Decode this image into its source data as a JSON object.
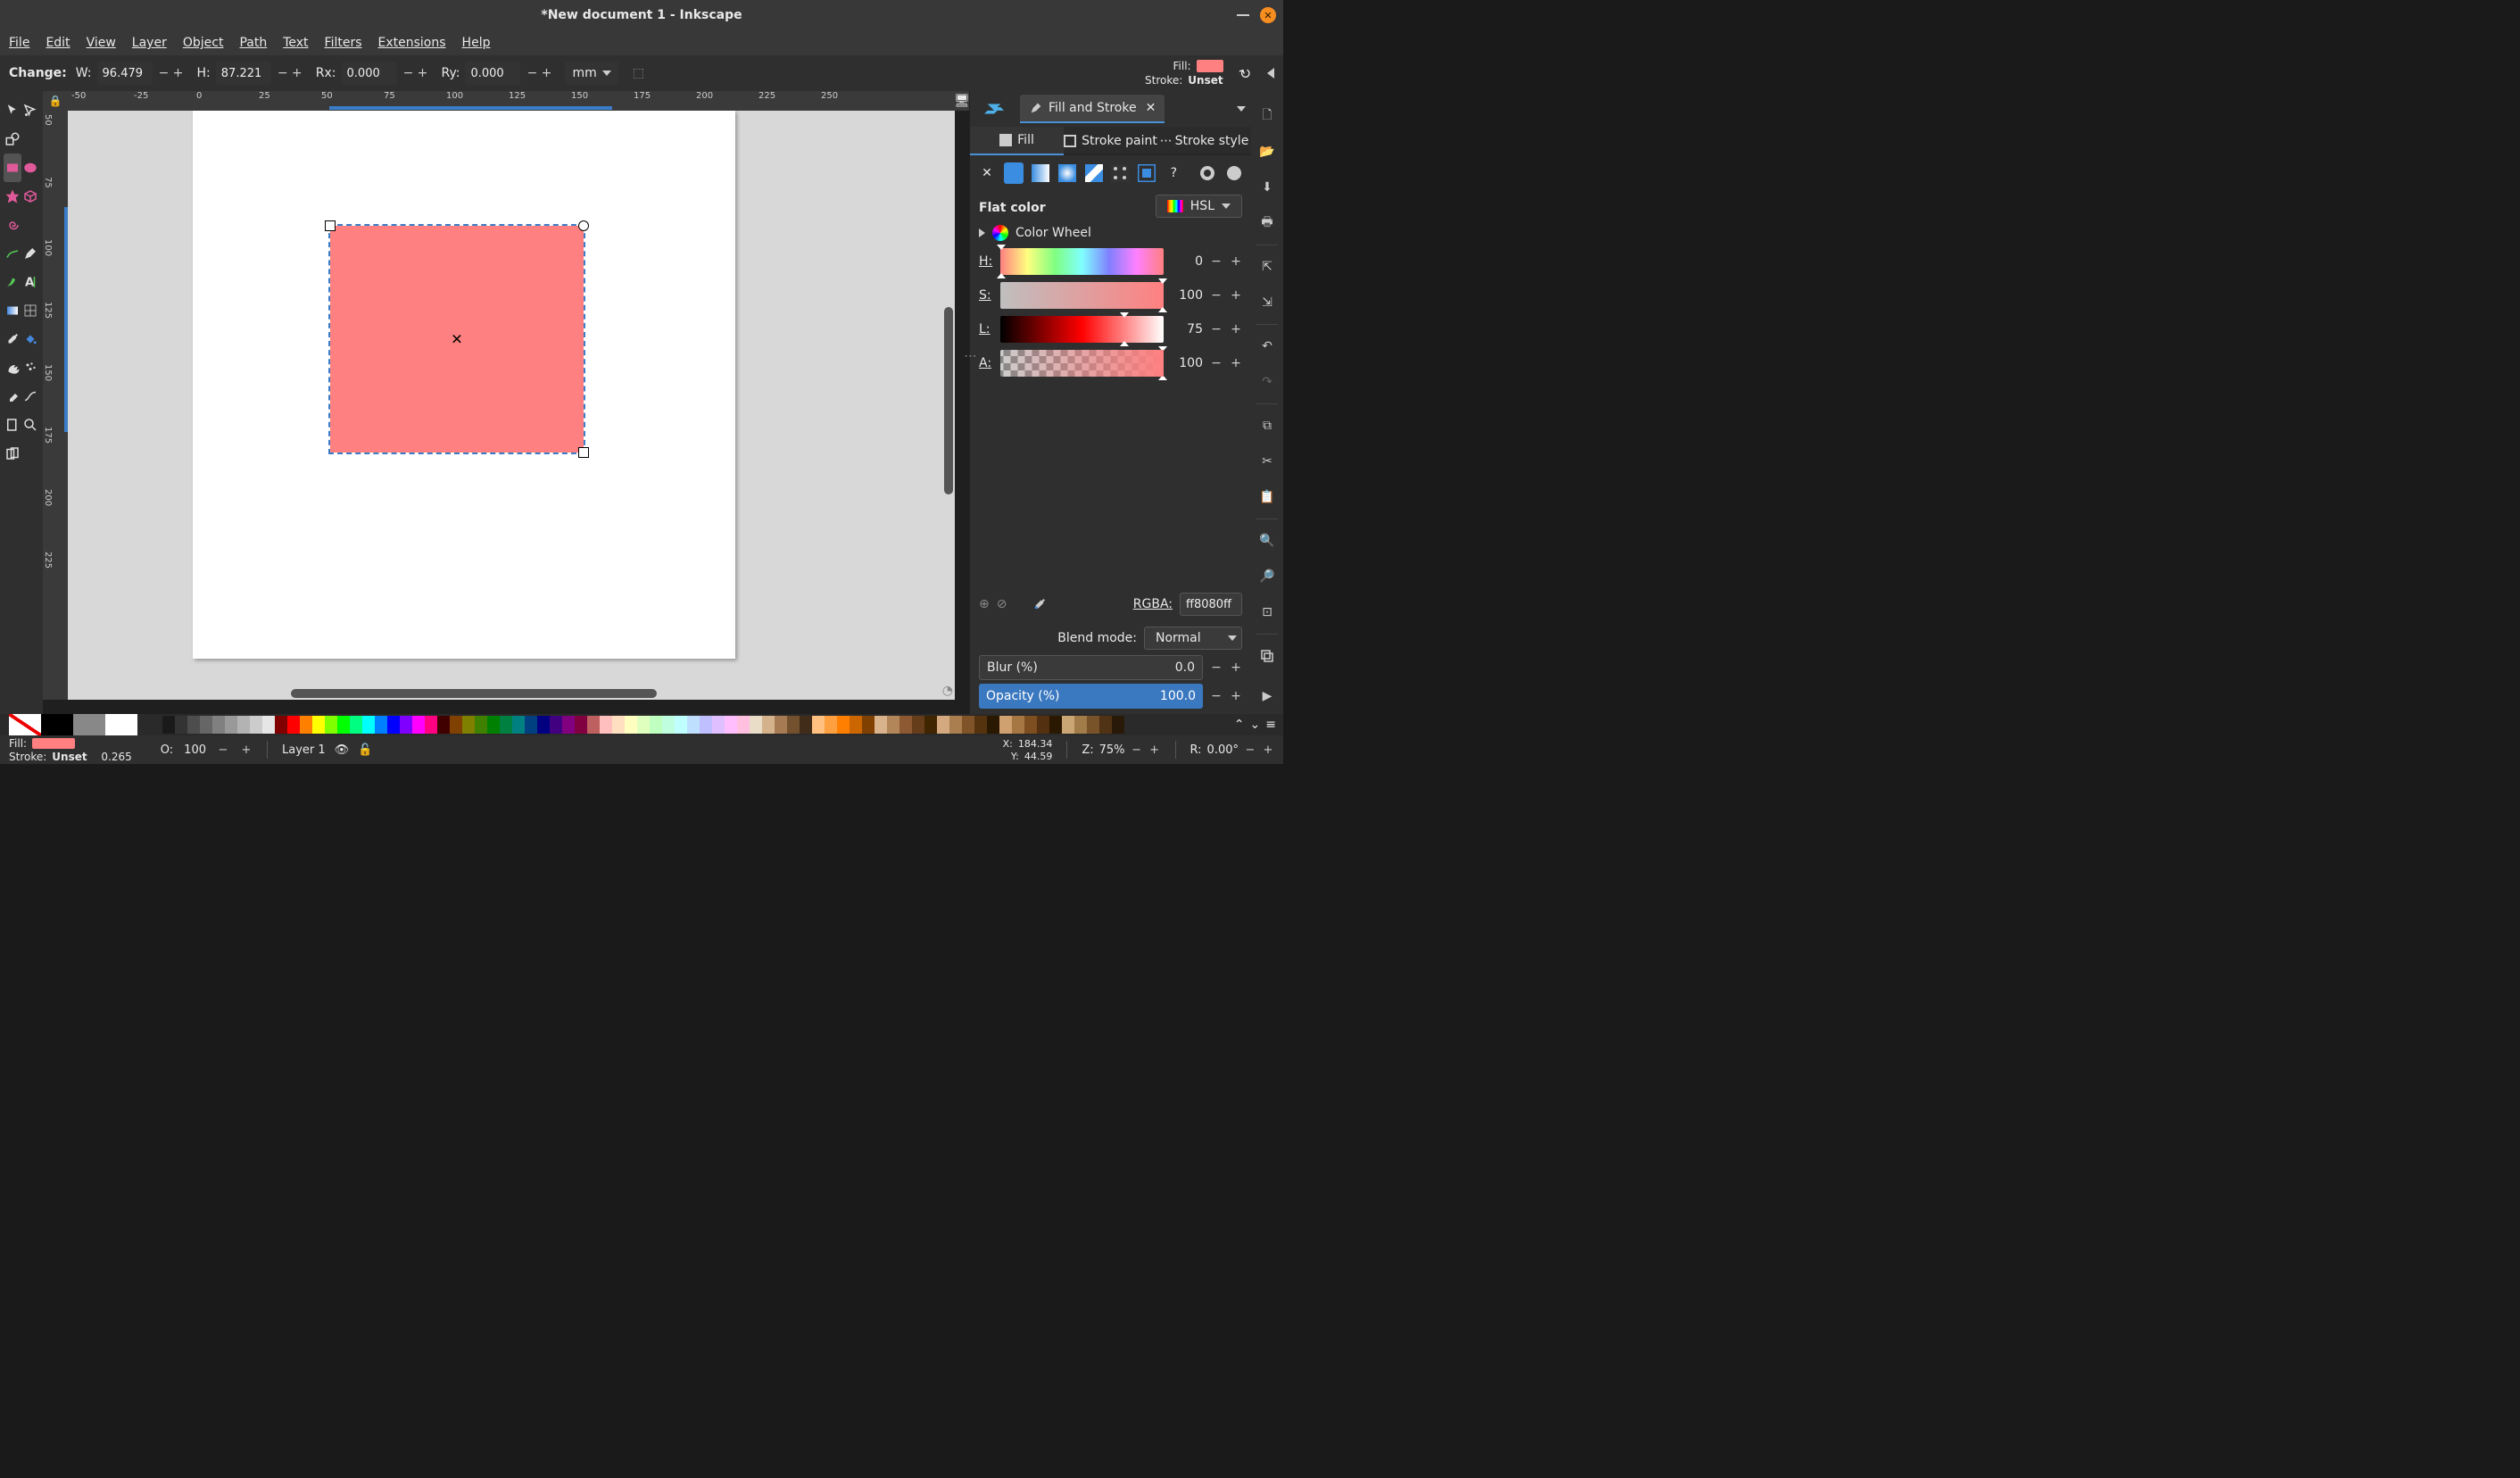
{
  "window": {
    "title": "*New document 1 - Inkscape"
  },
  "menu": [
    "File",
    "Edit",
    "View",
    "Layer",
    "Object",
    "Path",
    "Text",
    "Filters",
    "Extensions",
    "Help"
  ],
  "toolctrl": {
    "change_label": "Change:",
    "w_label": "W:",
    "w": "96.479",
    "h_label": "H:",
    "h": "87.221",
    "rx_label": "Rx:",
    "rx": "0.000",
    "ry_label": "Ry:",
    "ry": "0.000",
    "unit": "mm",
    "fill_label": "Fill:",
    "stroke_label": "Stroke:",
    "stroke_value": "Unset"
  },
  "ruler_top": [
    "-50",
    "-25",
    "0",
    "25",
    "50",
    "75",
    "100",
    "125",
    "150",
    "175",
    "200",
    "225",
    "250"
  ],
  "ruler_left": [
    "50",
    "75",
    "100",
    "125",
    "150",
    "175",
    "200",
    "225"
  ],
  "dock": {
    "tab_label": "Fill and Stroke",
    "fs_tabs": {
      "fill": "Fill",
      "stroke_paint": "Stroke paint",
      "stroke_style": "Stroke style"
    },
    "mode_label": "Flat color",
    "color_space": "HSL",
    "wheel_label": "Color Wheel",
    "sliders": {
      "h": {
        "label": "H:",
        "value": "0"
      },
      "s": {
        "label": "S:",
        "value": "100"
      },
      "l": {
        "label": "L:",
        "value": "75"
      },
      "a": {
        "label": "A:",
        "value": "100"
      }
    },
    "rgba_label": "RGBA:",
    "rgba_value": "ff8080ff",
    "blend_label": "Blend mode:",
    "blend_value": "Normal",
    "blur_label": "Blur (%)",
    "blur_value": "0.0",
    "opacity_label": "Opacity (%)",
    "opacity_value": "100.0"
  },
  "status": {
    "fill_label": "Fill:",
    "stroke_label": "Stroke:",
    "stroke_value": "Unset",
    "stroke_width": "0.265",
    "o_label": "O:",
    "o_value": "100",
    "layer": "Layer 1",
    "x_label": "X:",
    "x": "184.34",
    "y_label": "Y:",
    "y": "44.59",
    "z_label": "Z:",
    "z": "75%",
    "r_label": "R:",
    "r": "0.00°"
  }
}
